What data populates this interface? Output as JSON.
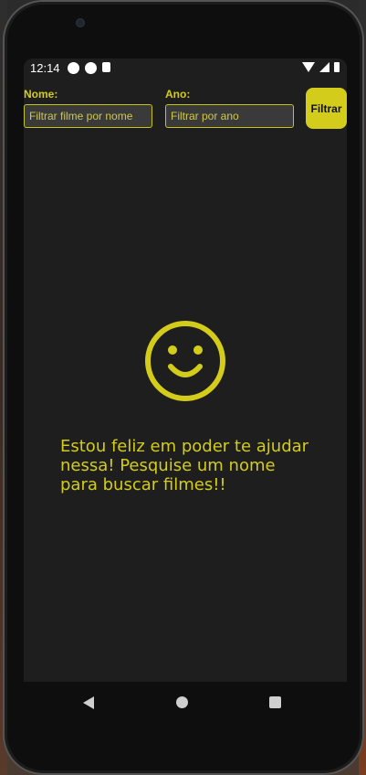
{
  "status_bar": {
    "time": "12:14",
    "icons": [
      "react-icon",
      "expo-icon",
      "sd-card-icon"
    ],
    "right_icons": [
      "wifi-icon",
      "signal-icon",
      "battery-icon"
    ]
  },
  "filters": {
    "name_label": "Nome:",
    "name_placeholder": "Filtrar filme por nome",
    "year_label": "Ano:",
    "year_placeholder": "Filtrar por ano",
    "button_label": "Filtrar"
  },
  "empty_state": {
    "icon": "smiley-face-icon",
    "message": "Estou feliz em poder te ajudar nessa! Pesquise um nome para buscar filmes!!"
  },
  "navigation": {
    "buttons": [
      "back-icon",
      "home-icon",
      "recents-icon"
    ]
  },
  "colors": {
    "accent": "#d4cc1a",
    "background": "#1e1e1e",
    "input_background": "#3a3a3a"
  }
}
